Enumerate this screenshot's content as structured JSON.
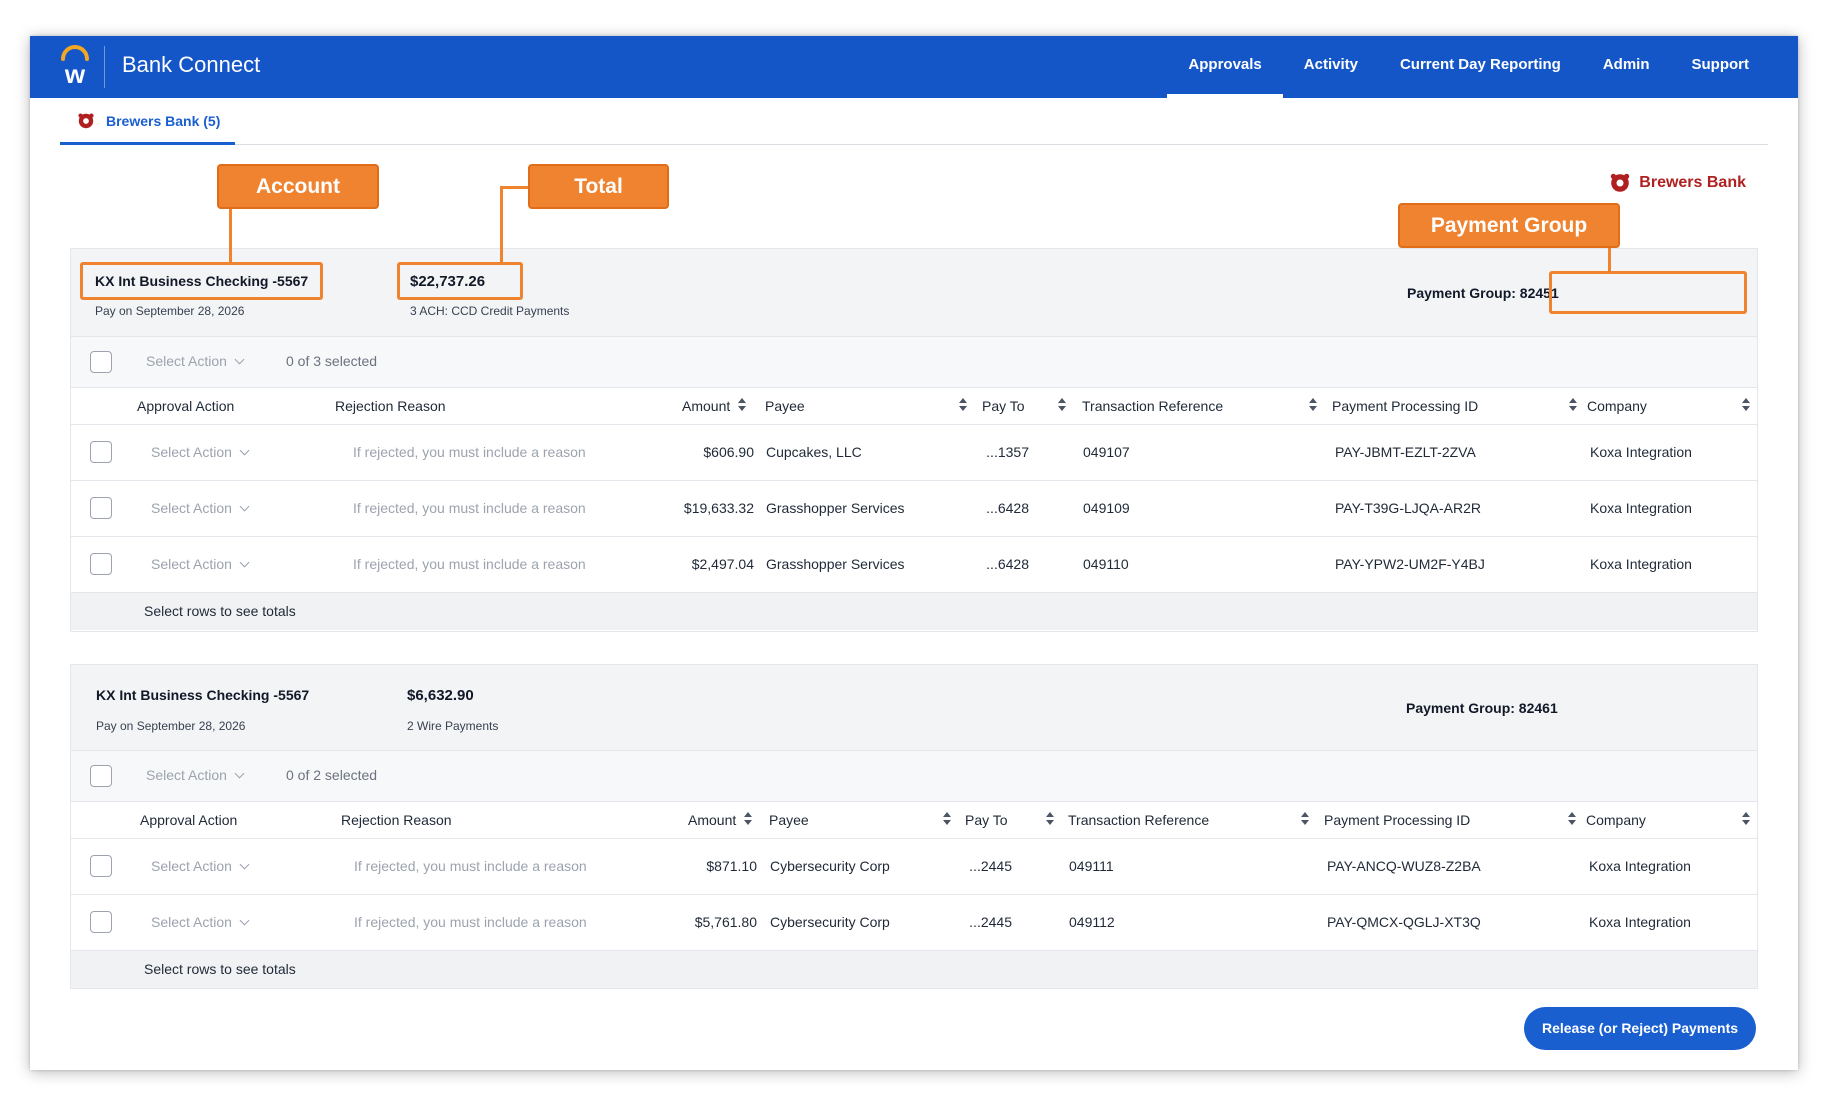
{
  "header": {
    "app_title": "Bank Connect",
    "nav": [
      "Approvals",
      "Activity",
      "Current Day Reporting",
      "Admin",
      "Support"
    ],
    "active_nav": "Approvals"
  },
  "tabs": [
    {
      "label": "Brewers Bank (5)",
      "active": true
    }
  ],
  "bank_brand": "Brewers Bank",
  "callouts": {
    "account": "Account",
    "total": "Total",
    "payment_group": "Payment Group"
  },
  "columns": {
    "approval_action": "Approval Action",
    "rejection_reason": "Rejection Reason",
    "amount": "Amount",
    "payee": "Payee",
    "pay_to": "Pay To",
    "transaction_reference": "Transaction Reference",
    "payment_processing_id": "Payment Processing ID",
    "company": "Company"
  },
  "select_action": "Select Action",
  "rejection_placeholder": "If rejected, you must include a reason",
  "footer_text": "Select rows to see totals",
  "groups": [
    {
      "account": "KX Int Business Checking -5567",
      "pay_date": "Pay on September 28, 2026",
      "total": "$22,737.26",
      "payment_summary": "3 ACH: CCD Credit Payments",
      "payment_group": "Payment Group: 82451",
      "selected_label": "0 of 3 selected",
      "rows": [
        {
          "amount": "$606.90",
          "payee": "Cupcakes, LLC",
          "pay_to": "...1357",
          "transaction_reference": "049107",
          "payment_processing_id": "PAY-JBMT-EZLT-2ZVA",
          "company": "Koxa Integration"
        },
        {
          "amount": "$19,633.32",
          "payee": "Grasshopper Services",
          "pay_to": "...6428",
          "transaction_reference": "049109",
          "payment_processing_id": "PAY-T39G-LJQA-AR2R",
          "company": "Koxa Integration"
        },
        {
          "amount": "$2,497.04",
          "payee": "Grasshopper Services",
          "pay_to": "...6428",
          "transaction_reference": "049110",
          "payment_processing_id": "PAY-YPW2-UM2F-Y4BJ",
          "company": "Koxa Integration"
        }
      ]
    },
    {
      "account": "KX Int Business Checking -5567",
      "pay_date": "Pay on September 28, 2026",
      "total": "$6,632.90",
      "payment_summary": "2 Wire Payments",
      "payment_group": "Payment Group: 82461",
      "selected_label": "0 of 2 selected",
      "rows": [
        {
          "amount": "$871.10",
          "payee": "Cybersecurity Corp",
          "pay_to": "...2445",
          "transaction_reference": "049111",
          "payment_processing_id": "PAY-ANCQ-WUZ8-Z2BA",
          "company": "Koxa Integration"
        },
        {
          "amount": "$5,761.80",
          "payee": "Cybersecurity Corp",
          "pay_to": "...2445",
          "transaction_reference": "049112",
          "payment_processing_id": "PAY-QMCX-QGLJ-XT3Q",
          "company": "Koxa Integration"
        }
      ]
    }
  ],
  "release_button": "Release (or Reject) Payments",
  "colors": {
    "brand_blue": "#1455c8",
    "callout_orange": "#ef8330",
    "bank_red": "#b02020"
  }
}
